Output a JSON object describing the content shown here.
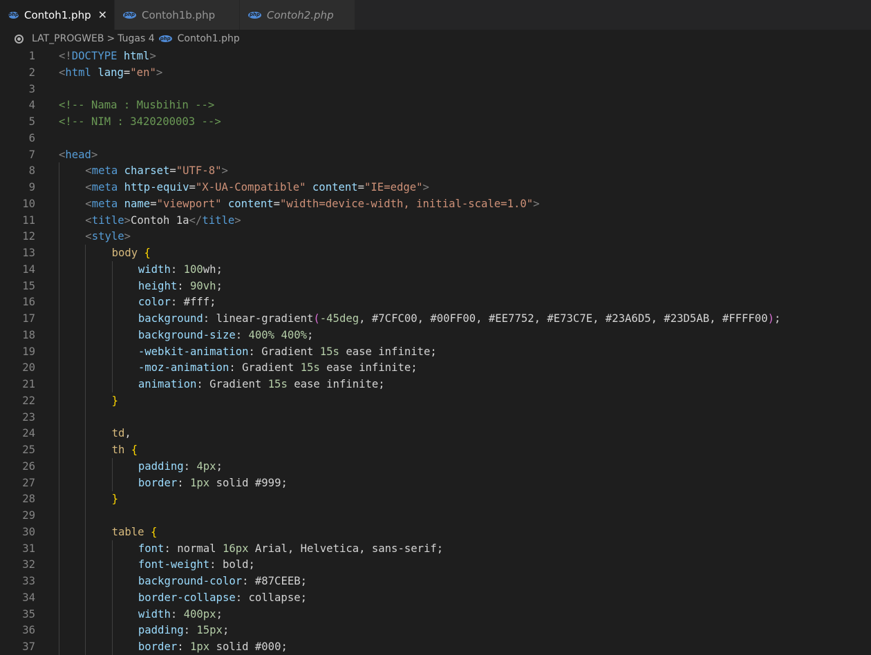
{
  "tabs": [
    {
      "label": "Contoh1.php",
      "active": true,
      "italic": false,
      "icon": "php-file-icon",
      "close": "✕"
    },
    {
      "label": "Contoh1b.php",
      "active": false,
      "italic": false,
      "icon": "php-file-icon"
    },
    {
      "label": "Contoh2.php",
      "active": false,
      "italic": true,
      "icon": "php-file-icon"
    }
  ],
  "breadcrumb": {
    "items": [
      "LAT_PROGWEB",
      "Tugas 4",
      "Contoh1.php"
    ],
    "separator": ">"
  },
  "colors": {
    "background": "#1e1e1e",
    "tabbar": "#252526",
    "tag": "#569cd6",
    "attribute": "#9cdcfe",
    "string": "#ce9178",
    "comment": "#6a9955",
    "selector": "#d7ba7d",
    "brace": "#ffd700",
    "number": "#b5cea8"
  },
  "code_lines": [
    {
      "n": "1",
      "indent": 0,
      "tokens": [
        [
          "punc",
          "<!"
        ],
        [
          "tag",
          "DOCTYPE"
        ],
        [
          "plain",
          " "
        ],
        [
          "attr",
          "html"
        ],
        [
          "punc",
          ">"
        ]
      ]
    },
    {
      "n": "2",
      "indent": 0,
      "tokens": [
        [
          "punc",
          "<"
        ],
        [
          "tag",
          "html"
        ],
        [
          "plain",
          " "
        ],
        [
          "attr",
          "lang"
        ],
        [
          "plain",
          "="
        ],
        [
          "str",
          "\"en\""
        ],
        [
          "punc",
          ">"
        ]
      ]
    },
    {
      "n": "3",
      "indent": 0,
      "tokens": []
    },
    {
      "n": "4",
      "indent": 0,
      "tokens": [
        [
          "com",
          "<!-- Nama : Musbihin -->"
        ]
      ]
    },
    {
      "n": "5",
      "indent": 0,
      "tokens": [
        [
          "com",
          "<!-- NIM : 3420200003 -->"
        ]
      ]
    },
    {
      "n": "6",
      "indent": 0,
      "tokens": []
    },
    {
      "n": "7",
      "indent": 0,
      "tokens": [
        [
          "punc",
          "<"
        ],
        [
          "tag",
          "head"
        ],
        [
          "punc",
          ">"
        ]
      ]
    },
    {
      "n": "8",
      "indent": 1,
      "tokens": [
        [
          "punc",
          "<"
        ],
        [
          "tag",
          "meta"
        ],
        [
          "plain",
          " "
        ],
        [
          "attr",
          "charset"
        ],
        [
          "plain",
          "="
        ],
        [
          "str",
          "\"UTF-8\""
        ],
        [
          "punc",
          ">"
        ]
      ]
    },
    {
      "n": "9",
      "indent": 1,
      "tokens": [
        [
          "punc",
          "<"
        ],
        [
          "tag",
          "meta"
        ],
        [
          "plain",
          " "
        ],
        [
          "attr",
          "http-equiv"
        ],
        [
          "plain",
          "="
        ],
        [
          "str",
          "\"X-UA-Compatible\""
        ],
        [
          "plain",
          " "
        ],
        [
          "attr",
          "content"
        ],
        [
          "plain",
          "="
        ],
        [
          "str",
          "\"IE=edge\""
        ],
        [
          "punc",
          ">"
        ]
      ]
    },
    {
      "n": "10",
      "indent": 1,
      "tokens": [
        [
          "punc",
          "<"
        ],
        [
          "tag",
          "meta"
        ],
        [
          "plain",
          " "
        ],
        [
          "attr",
          "name"
        ],
        [
          "plain",
          "="
        ],
        [
          "str",
          "\"viewport\""
        ],
        [
          "plain",
          " "
        ],
        [
          "attr",
          "content"
        ],
        [
          "plain",
          "="
        ],
        [
          "str",
          "\"width=device-width, initial-scale=1.0\""
        ],
        [
          "punc",
          ">"
        ]
      ]
    },
    {
      "n": "11",
      "indent": 1,
      "tokens": [
        [
          "punc",
          "<"
        ],
        [
          "tag",
          "title"
        ],
        [
          "punc",
          ">"
        ],
        [
          "text",
          "Contoh 1a"
        ],
        [
          "punc",
          "</"
        ],
        [
          "tag",
          "title"
        ],
        [
          "punc",
          ">"
        ]
      ]
    },
    {
      "n": "12",
      "indent": 1,
      "tokens": [
        [
          "punc",
          "<"
        ],
        [
          "tag",
          "style"
        ],
        [
          "punc",
          ">"
        ]
      ]
    },
    {
      "n": "13",
      "indent": 2,
      "tokens": [
        [
          "sel",
          "body"
        ],
        [
          "plain",
          " "
        ],
        [
          "brace",
          "{"
        ]
      ]
    },
    {
      "n": "14",
      "indent": 3,
      "tokens": [
        [
          "attr",
          "width"
        ],
        [
          "plain",
          ": "
        ],
        [
          "num",
          "100"
        ],
        [
          "plain",
          "wh;"
        ]
      ]
    },
    {
      "n": "15",
      "indent": 3,
      "tokens": [
        [
          "attr",
          "height"
        ],
        [
          "plain",
          ": "
        ],
        [
          "num",
          "90vh"
        ],
        [
          "plain",
          ";"
        ]
      ]
    },
    {
      "n": "16",
      "indent": 3,
      "tokens": [
        [
          "attr",
          "color"
        ],
        [
          "plain",
          ": #fff;"
        ]
      ]
    },
    {
      "n": "17",
      "indent": 3,
      "tokens": [
        [
          "attr",
          "background"
        ],
        [
          "plain",
          ": linear-gradient"
        ],
        [
          "paren",
          "("
        ],
        [
          "num",
          "-45deg"
        ],
        [
          "plain",
          ", #7CFC00, #00FF00, #EE7752, #E73C7E, #23A6D5, #23D5AB, #FFFF00"
        ],
        [
          "paren",
          ")"
        ],
        [
          "plain",
          ";"
        ]
      ]
    },
    {
      "n": "18",
      "indent": 3,
      "tokens": [
        [
          "attr",
          "background-size"
        ],
        [
          "plain",
          ": "
        ],
        [
          "num",
          "400%"
        ],
        [
          "plain",
          " "
        ],
        [
          "num",
          "400%"
        ],
        [
          "plain",
          ";"
        ]
      ]
    },
    {
      "n": "19",
      "indent": 3,
      "tokens": [
        [
          "attr",
          "-webkit-animation"
        ],
        [
          "plain",
          ": Gradient "
        ],
        [
          "num",
          "15s"
        ],
        [
          "plain",
          " ease infinite;"
        ]
      ]
    },
    {
      "n": "20",
      "indent": 3,
      "tokens": [
        [
          "attr",
          "-moz-animation"
        ],
        [
          "plain",
          ": Gradient "
        ],
        [
          "num",
          "15s"
        ],
        [
          "plain",
          " ease infinite;"
        ]
      ]
    },
    {
      "n": "21",
      "indent": 3,
      "tokens": [
        [
          "attr",
          "animation"
        ],
        [
          "plain",
          ": Gradient "
        ],
        [
          "num",
          "15s"
        ],
        [
          "plain",
          " ease infinite;"
        ]
      ]
    },
    {
      "n": "22",
      "indent": 2,
      "tokens": [
        [
          "brace",
          "}"
        ]
      ]
    },
    {
      "n": "23",
      "indent": 0,
      "tokens": []
    },
    {
      "n": "24",
      "indent": 2,
      "tokens": [
        [
          "sel",
          "td"
        ],
        [
          "plain",
          ","
        ]
      ]
    },
    {
      "n": "25",
      "indent": 2,
      "tokens": [
        [
          "sel",
          "th"
        ],
        [
          "plain",
          " "
        ],
        [
          "brace",
          "{"
        ]
      ]
    },
    {
      "n": "26",
      "indent": 3,
      "tokens": [
        [
          "attr",
          "padding"
        ],
        [
          "plain",
          ": "
        ],
        [
          "num",
          "4px"
        ],
        [
          "plain",
          ";"
        ]
      ]
    },
    {
      "n": "27",
      "indent": 3,
      "tokens": [
        [
          "attr",
          "border"
        ],
        [
          "plain",
          ": "
        ],
        [
          "num",
          "1px"
        ],
        [
          "plain",
          " solid #999;"
        ]
      ]
    },
    {
      "n": "28",
      "indent": 2,
      "tokens": [
        [
          "brace",
          "}"
        ]
      ]
    },
    {
      "n": "29",
      "indent": 0,
      "tokens": []
    },
    {
      "n": "30",
      "indent": 2,
      "tokens": [
        [
          "sel",
          "table"
        ],
        [
          "plain",
          " "
        ],
        [
          "brace",
          "{"
        ]
      ]
    },
    {
      "n": "31",
      "indent": 3,
      "tokens": [
        [
          "attr",
          "font"
        ],
        [
          "plain",
          ": normal "
        ],
        [
          "num",
          "16px"
        ],
        [
          "plain",
          " Arial, Helvetica, sans-serif;"
        ]
      ]
    },
    {
      "n": "32",
      "indent": 3,
      "tokens": [
        [
          "attr",
          "font-weight"
        ],
        [
          "plain",
          ": bold;"
        ]
      ]
    },
    {
      "n": "33",
      "indent": 3,
      "tokens": [
        [
          "attr",
          "background-color"
        ],
        [
          "plain",
          ": #87CEEB;"
        ]
      ]
    },
    {
      "n": "34",
      "indent": 3,
      "tokens": [
        [
          "attr",
          "border-collapse"
        ],
        [
          "plain",
          ": collapse;"
        ]
      ]
    },
    {
      "n": "35",
      "indent": 3,
      "tokens": [
        [
          "attr",
          "width"
        ],
        [
          "plain",
          ": "
        ],
        [
          "num",
          "400px"
        ],
        [
          "plain",
          ";"
        ]
      ]
    },
    {
      "n": "36",
      "indent": 3,
      "tokens": [
        [
          "attr",
          "padding"
        ],
        [
          "plain",
          ": "
        ],
        [
          "num",
          "15px"
        ],
        [
          "plain",
          ";"
        ]
      ]
    },
    {
      "n": "37",
      "indent": 3,
      "tokens": [
        [
          "attr",
          "border"
        ],
        [
          "plain",
          ": "
        ],
        [
          "num",
          "1px"
        ],
        [
          "plain",
          " solid #000;"
        ]
      ]
    }
  ]
}
